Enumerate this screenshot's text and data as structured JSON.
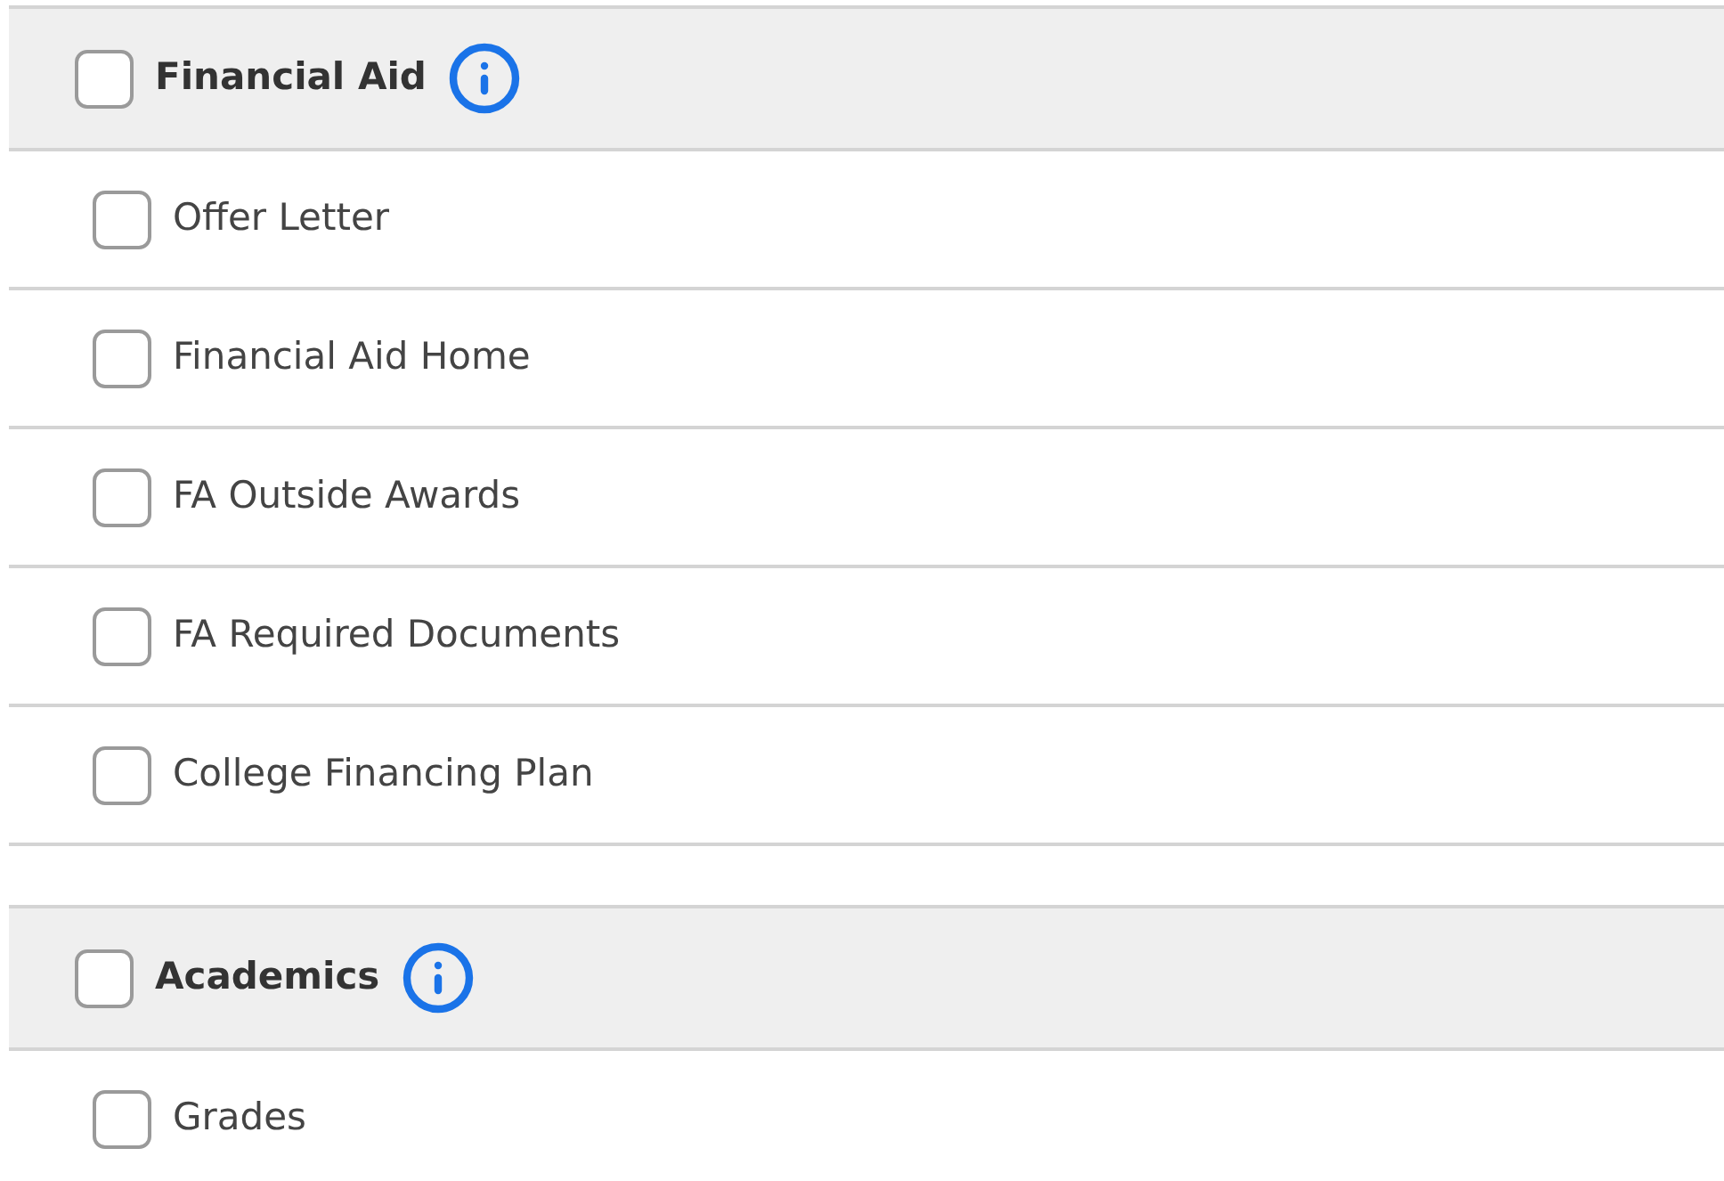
{
  "sections": [
    {
      "title": "Financial Aid",
      "checked": false,
      "items": [
        {
          "label": "Offer Letter",
          "checked": false
        },
        {
          "label": "Financial Aid Home",
          "checked": false
        },
        {
          "label": "FA Outside Awards",
          "checked": false
        },
        {
          "label": "FA Required Documents",
          "checked": false
        },
        {
          "label": "College Financing Plan",
          "checked": false
        }
      ]
    },
    {
      "title": "Academics",
      "checked": false,
      "items": [
        {
          "label": "Grades",
          "checked": false
        }
      ]
    }
  ]
}
